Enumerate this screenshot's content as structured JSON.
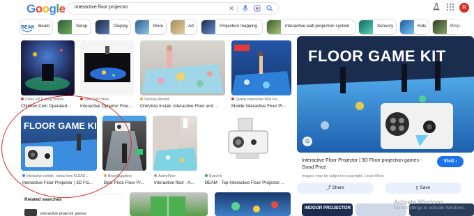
{
  "header": {
    "logo": "Google",
    "query": "interactive floor projector",
    "avatar_letter": "R"
  },
  "chips": [
    {
      "label": "Beam",
      "thumb_color": "#1565c0"
    },
    {
      "label": "Setup",
      "thumb_color": "#3a5f3a"
    },
    {
      "label": "Display",
      "thumb_color": "#2b3a55"
    },
    {
      "label": "Store",
      "thumb_color": "#3b6d9c"
    },
    {
      "label": "Art",
      "thumb_color": "#8e7a4b"
    },
    {
      "label": "Projection mapping",
      "thumb_color": "#243c62"
    },
    {
      "label": "Interactive wall projection system",
      "thumb_color": "#4f6a3f"
    },
    {
      "label": "Sensory",
      "thumb_color": "#1f7a6f"
    },
    {
      "label": "Kids",
      "thumb_color": "#2a6fb0"
    },
    {
      "label": "Proje",
      "thumb_color": "#3c4d2f"
    }
  ],
  "results": [
    {
      "source": "China VR Racing Simula...",
      "title": "Children Coin Operated...",
      "dot": "#e53935"
    },
    {
      "source": "New Tech Store",
      "title": "Interactive Dynamic Floo...",
      "dot": "#d93025"
    },
    {
      "source": "Sensory Wizard",
      "title": "OmiVista Install- Interactive Floor and ...",
      "dot": "#f4a32a"
    },
    {
      "source": "Quality Interactive Wall Flo...",
      "title": "Mobile Interactive Floor Pr...",
      "dot": "#e53935"
    },
    {
      "source": "interactive exhibit - ideas from KLEAD...",
      "title": "Interactive Floor Projector | 3D Flo...",
      "dot": "#4285f4"
    },
    {
      "source": "BeamSuppliers",
      "title": "Best Price Floor Pr...",
      "dot": "#f4a32a"
    },
    {
      "source": "ActiveFloor",
      "title": "Interactive floor - A...",
      "dot": "#9aa0a6"
    },
    {
      "source": "Eyeclick",
      "title": "BEAM - Top Interactive Floor Projector ...",
      "dot": "#34a853"
    }
  ],
  "panel": {
    "image_text": "FLOOR GAME KIT",
    "title": "Interactive Floor Projector | 3D Floor projection games - Good Price",
    "note": "Images may be subject to copyright. Learn More",
    "visit_label": "Visit",
    "share_label": "Share",
    "save_label": "Save",
    "bottom_thumb_text": "INDOOR PROJECTOR"
  },
  "thumb_text": "FLOOR GAME KIT",
  "related": {
    "heading": "Related searches",
    "item": "interactive projector games"
  },
  "watermark": {
    "line1": "Activate Windows",
    "line2": "Go to Settings to activate Windows."
  }
}
